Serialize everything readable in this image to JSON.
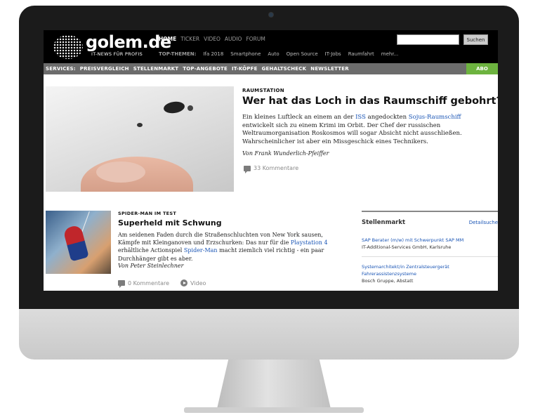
{
  "header": {
    "logo_text": "golem.de",
    "tagline": "IT-NEWS FÜR PROFIS",
    "nav": [
      "HOME",
      "TICKER",
      "VIDEO",
      "AUDIO",
      "FORUM"
    ],
    "topics_label": "TOP-THEMEN:",
    "topics": [
      "Ifa 2018",
      "Smartphone",
      "Auto",
      "Open Source",
      "IT-Jobs",
      "Raumfahrt",
      "mehr..."
    ],
    "search_button": "Suchen",
    "search_placeholder": ""
  },
  "services": {
    "label": "SERVICES:",
    "items": [
      "PREISVERGLEICH",
      "STELLENMARKT",
      "TOP-ANGEBOTE",
      "IT-KÖPFE",
      "GEHALTSCHECK",
      "NEWSLETTER"
    ],
    "abo": "ABO"
  },
  "lead": {
    "kicker": "RAUMSTATION",
    "title": "Wer hat das Loch in das Raumschiff gebohrt?",
    "teaser_1": "Ein kleines Luftleck an einem an der ",
    "link_1": "ISS",
    "teaser_2": " angedockten ",
    "link_2": "Sojus-Raumschiff",
    "teaser_3": " entwickelt sich zu einem Krimi im Orbit. Der Chef der russischen Weltraumorganisation Roskosmos will sogar Absicht nicht ausschließen. Wahrscheinlicher ist aber ein Missgeschick eines Technikers.",
    "byline": "Von Frank Wunderlich-Pfeiffer",
    "comments": "33 Kommentare"
  },
  "second": {
    "kicker": "SPIDER-MAN IM TEST",
    "title": "Superheld mit Schwung",
    "teaser_1": "Am seidenen Faden durch die Straßenschluchten von New York sausen, Kämpfe mit Kleinganoven und Erzschurken: Das nur für die ",
    "link_1": "Playstation 4",
    "teaser_2": " erhältliche Actionspiel ",
    "link_2": "Spider-Man",
    "teaser_3": " macht ziemlich viel richtig - ein paar Durchhänger gibt es aber.",
    "byline": "Von Peter Steinlechner",
    "comments": "0 Kommentare",
    "video": "Video"
  },
  "jobs": {
    "title": "Stellenmarkt",
    "more": "Detailsuche",
    "items": [
      {
        "title": "SAP Berater (m/w) mit Schwerpunkt SAP MM",
        "company": "IT-Additional-Services GmbH, Karlsruhe"
      },
      {
        "title": "Systemarchitekt/in Zentralsteuergerät Fahrerassistenzsysteme",
        "company": "Bosch Gruppe, Abstatt"
      }
    ]
  },
  "colors": {
    "accent_link": "#1a55b5",
    "abo_green": "#6db33f",
    "services_bar": "#6c6c6c"
  }
}
